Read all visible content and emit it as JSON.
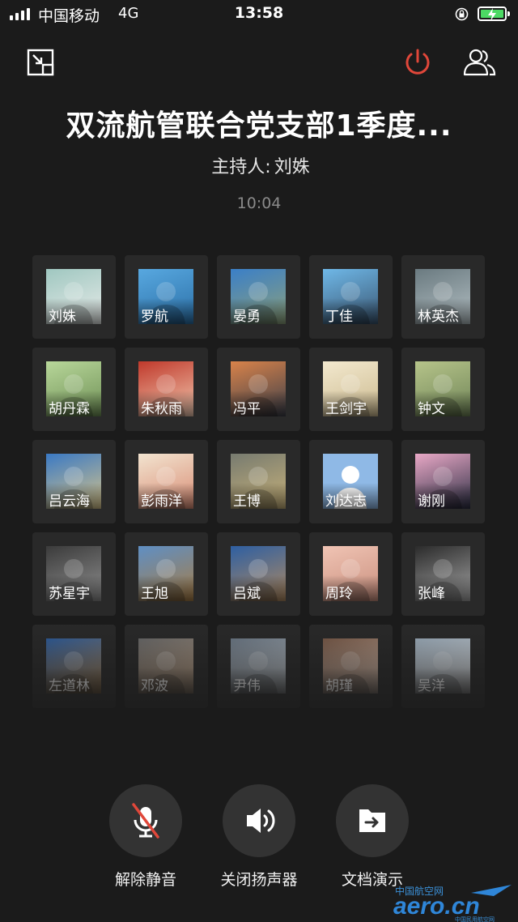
{
  "status_bar": {
    "carrier": "中国移动",
    "network": "4G",
    "time": "13:58"
  },
  "meeting": {
    "title": "双流航管联合党支部1季度...",
    "host_label": "主持人:",
    "host_name": "刘姝",
    "elapsed": "10:04"
  },
  "participants": [
    {
      "name": "刘姝",
      "colors": [
        "#9fc7c0",
        "#e9ecea"
      ]
    },
    {
      "name": "罗航",
      "colors": [
        "#58a8e0",
        "#2b6fa6"
      ]
    },
    {
      "name": "晏勇",
      "colors": [
        "#3a7fc8",
        "#8ea17a"
      ]
    },
    {
      "name": "丁佳",
      "colors": [
        "#6fb8e8",
        "#3a5570"
      ]
    },
    {
      "name": "林英杰",
      "colors": [
        "#6a7a80",
        "#b4c0c4"
      ]
    },
    {
      "name": "胡丹霖",
      "colors": [
        "#b8d79a",
        "#6e8f55"
      ]
    },
    {
      "name": "朱秋雨",
      "colors": [
        "#c0392b",
        "#f1c9b0"
      ]
    },
    {
      "name": "冯平",
      "colors": [
        "#d9834a",
        "#3c3f4a"
      ]
    },
    {
      "name": "王剑宇",
      "colors": [
        "#f3e9cf",
        "#cbb98e"
      ]
    },
    {
      "name": "钟文",
      "colors": [
        "#b6c48a",
        "#6f8457"
      ]
    },
    {
      "name": "吕云海",
      "colors": [
        "#3a79c4",
        "#d9c58a"
      ]
    },
    {
      "name": "彭雨洋",
      "colors": [
        "#f2e4d0",
        "#d98c74"
      ]
    },
    {
      "name": "王博",
      "colors": [
        "#777b70",
        "#c8b27a"
      ]
    },
    {
      "name": "刘达志",
      "colors": [
        "#8fb9e6",
        "#8fb9e6"
      ]
    },
    {
      "name": "谢刚",
      "colors": [
        "#e9a8c6",
        "#2c2f44"
      ]
    },
    {
      "name": "苏星宇",
      "colors": [
        "#3b3b3b",
        "#909090"
      ]
    },
    {
      "name": "王旭",
      "colors": [
        "#5f8fc4",
        "#a77d45"
      ]
    },
    {
      "name": "吕斌",
      "colors": [
        "#2e5fa2",
        "#b08a60"
      ]
    },
    {
      "name": "周玲",
      "colors": [
        "#f0c4b4",
        "#c98f7e"
      ]
    },
    {
      "name": "张峰",
      "colors": [
        "#2b2b2b",
        "#a5a5a5"
      ]
    },
    {
      "name": "左道林",
      "colors": [
        "#2d5d9e",
        "#b48a55"
      ]
    },
    {
      "name": "邓波",
      "colors": [
        "#6b6b6b",
        "#c9a98a"
      ]
    },
    {
      "name": "尹伟",
      "colors": [
        "#6d7a88",
        "#cfd4d8"
      ]
    },
    {
      "name": "胡瑾",
      "colors": [
        "#7a5a48",
        "#e7cdbb"
      ]
    },
    {
      "name": "吴洋",
      "colors": [
        "#9fb0bf",
        "#e8e8e8"
      ]
    }
  ],
  "controls": {
    "unmute": "解除静音",
    "speaker_off": "关闭扬声器",
    "doc_share": "文档演示"
  },
  "colors": {
    "background": "#1b1b1b",
    "tile": "#292929",
    "power_red": "#e0473a",
    "battery_green": "#4cd964"
  },
  "watermark": {
    "text": "aero.cn",
    "subtext": "中国航空网"
  }
}
